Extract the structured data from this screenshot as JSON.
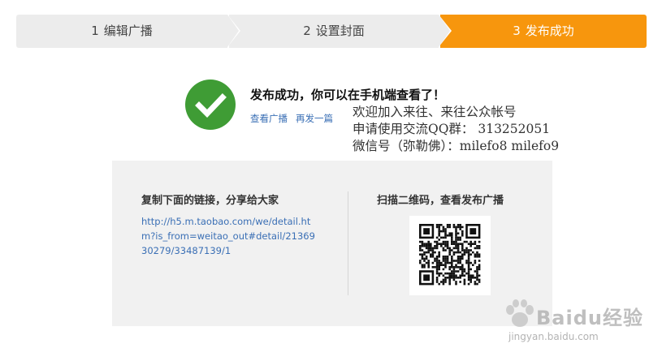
{
  "steps": [
    {
      "num": "1",
      "label": "编辑广播",
      "active": false
    },
    {
      "num": "2",
      "label": "设置封面",
      "active": false
    },
    {
      "num": "3",
      "label": "发布成功",
      "active": true
    }
  ],
  "colors": {
    "active_step": "#f7960d",
    "inactive_step": "#ececec",
    "success": "#3f9c35",
    "link": "#3a6fb5"
  },
  "success": {
    "icon": "checkmark-icon",
    "title": "发布成功，你可以在手机端查看了！",
    "view_link": "查看广播",
    "again_link": "再发一篇"
  },
  "overlay_note": {
    "line1": "欢迎加入来往、来往公众帐号",
    "line2": "申请使用交流QQ群：  313252051",
    "line3": "微信号（弥勒佛）：milefo8  milefo9"
  },
  "share": {
    "copy_title": "复制下面的链接，分享给大家",
    "url": "http://h5.m.taobao.com/we/detail.htm?is_from=weitao_out#detail/2136930279/33487139/1",
    "scan_title": "扫描二维码，查看发布广播",
    "qr_icon": "qr-code-icon"
  },
  "watermark": {
    "brand": "Baidu经验",
    "url": "jingyan.baidu.com"
  }
}
